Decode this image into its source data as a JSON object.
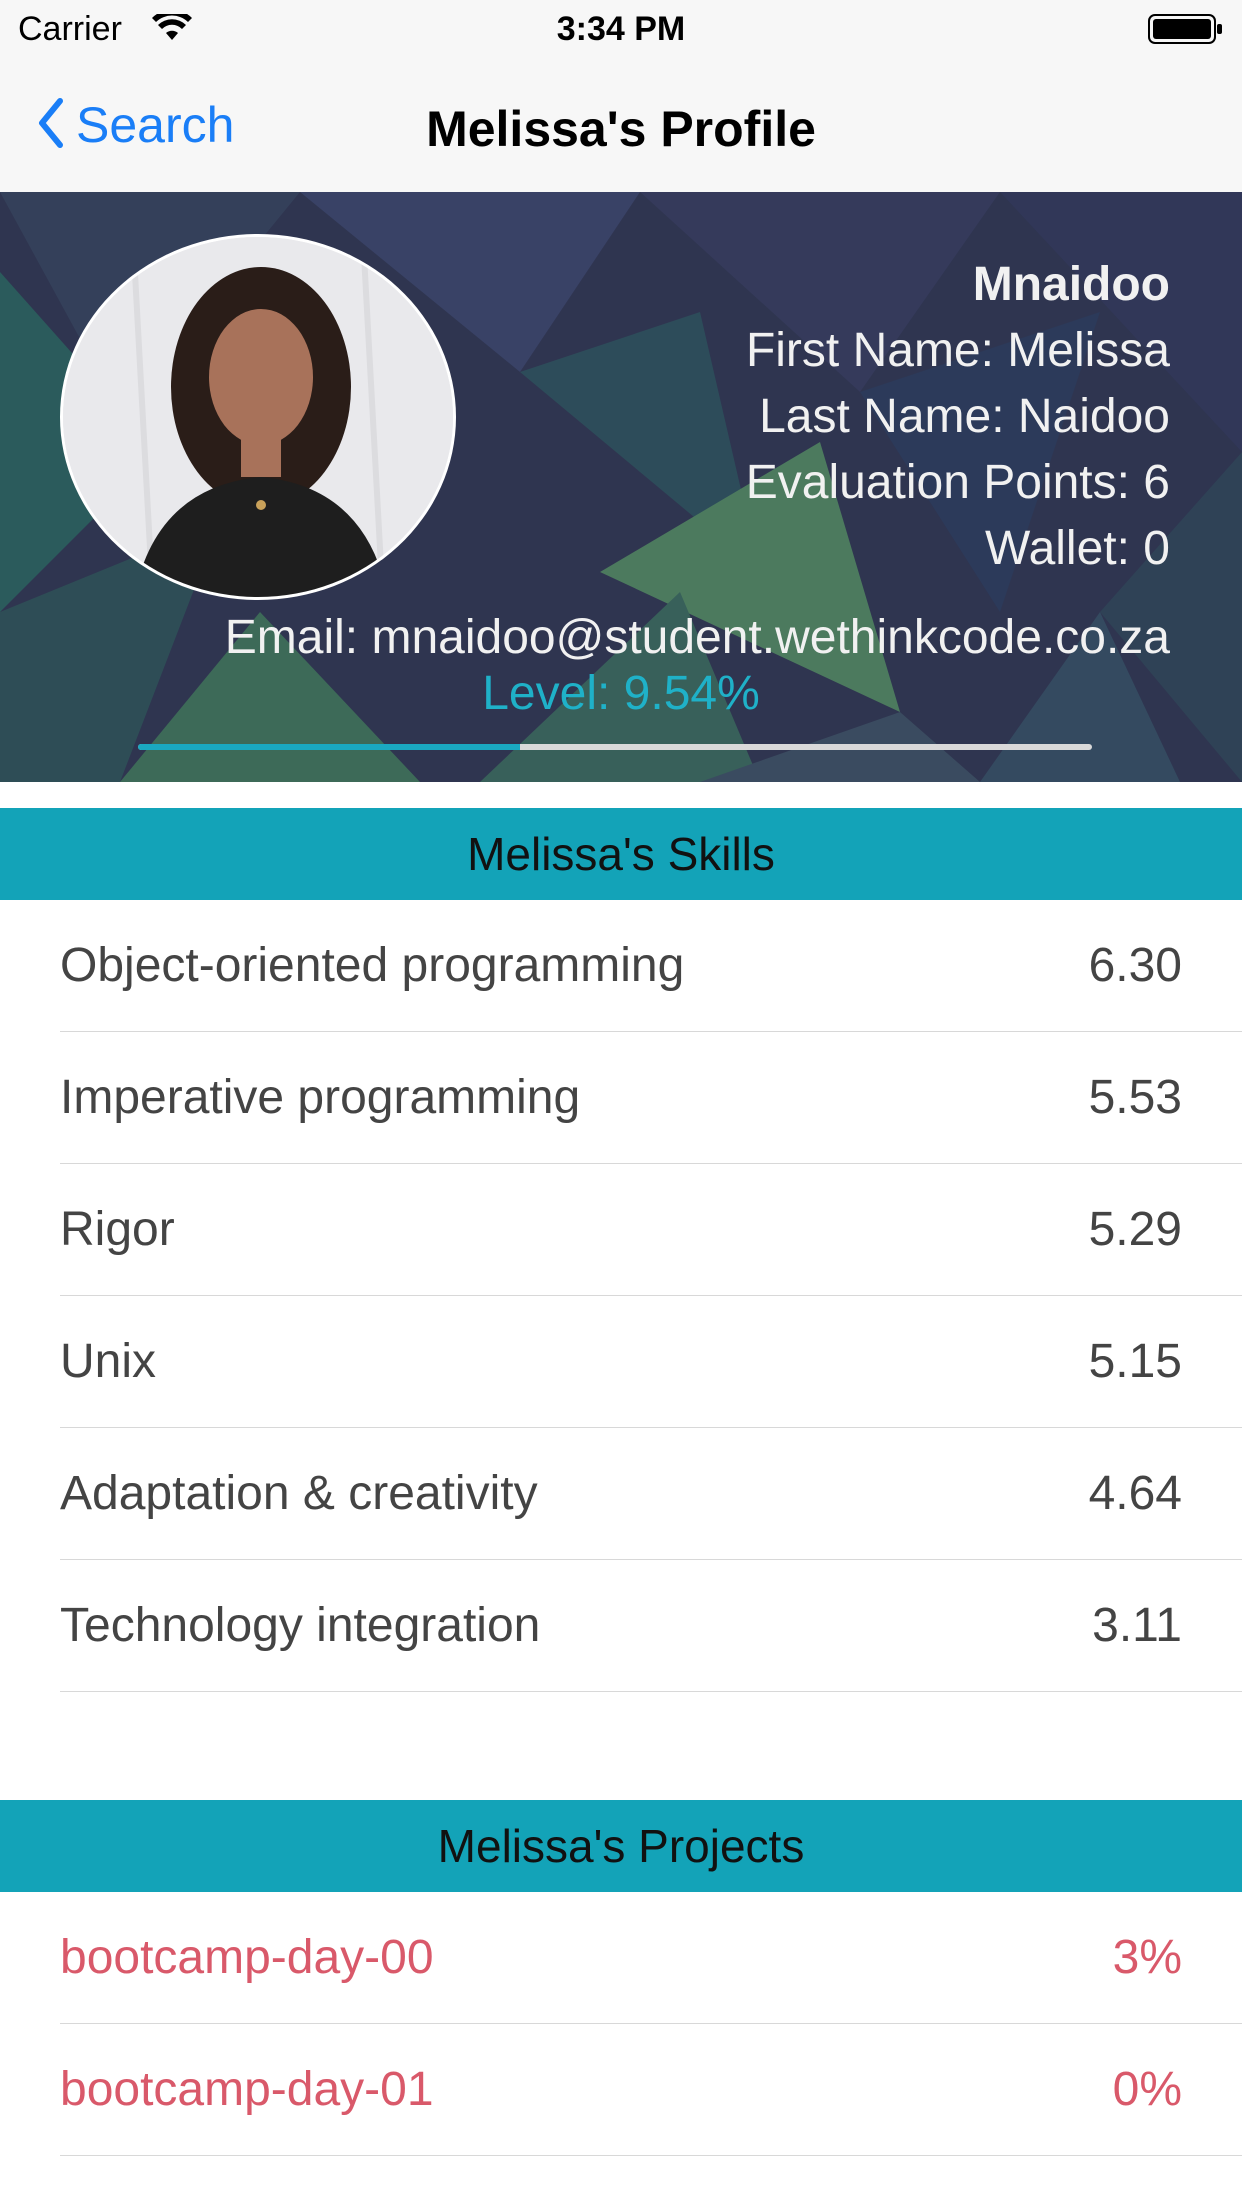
{
  "status_bar": {
    "carrier": "Carrier",
    "time": "3:34 PM"
  },
  "nav": {
    "back_label": "Search",
    "title": "Melissa's Profile"
  },
  "profile": {
    "login": "Mnaidoo",
    "first_name": "First Name: Melissa",
    "last_name": "Last Name: Naidoo",
    "evaluation_points": "Evaluation Points: 6",
    "wallet": "Wallet: 0",
    "email": "Email: mnaidoo@student.wethinkcode.co.za",
    "level_label": "Level: 9.54%",
    "level_progress": 0.4
  },
  "skills": {
    "title": "Melissa's Skills",
    "items": [
      {
        "name": "Object-oriented programming",
        "value": "6.30"
      },
      {
        "name": "Imperative programming",
        "value": "5.53"
      },
      {
        "name": "Rigor",
        "value": "5.29"
      },
      {
        "name": "Unix",
        "value": "5.15"
      },
      {
        "name": "Adaptation & creativity",
        "value": "4.64"
      },
      {
        "name": "Technology integration",
        "value": "3.11"
      }
    ]
  },
  "projects": {
    "title": "Melissa's Projects",
    "items": [
      {
        "name": "bootcamp-day-00",
        "value": "3%"
      },
      {
        "name": "bootcamp-day-01",
        "value": "0%"
      }
    ]
  },
  "colors": {
    "accent": "#13a3b8",
    "link": "#1a7ef7",
    "project_text": "#d9596a",
    "header_bg": "#2f3550"
  }
}
